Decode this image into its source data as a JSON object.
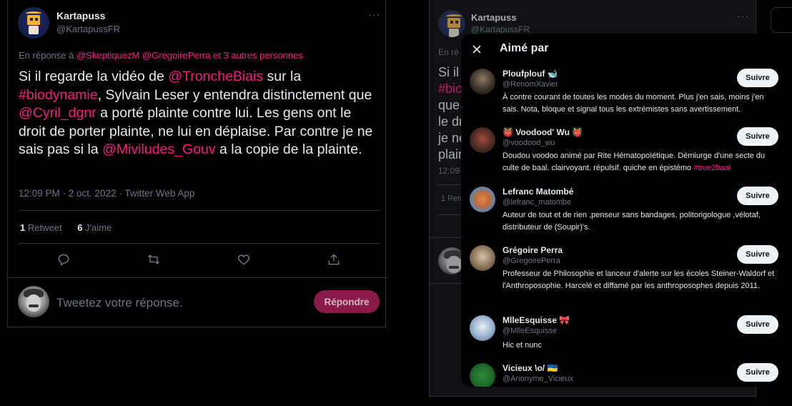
{
  "left_tweet": {
    "author_name": "Kartapuss",
    "author_handle": "@KartapussFR",
    "reply_prefix": "En réponse à",
    "reply_mentions": "@SkeptiquezM @GregoirePerra  et 3 autres personnes",
    "text_parts": {
      "p1": "Si il regarde la vidéo de ",
      "m1": "@TroncheBiais",
      "p2": " sur la ",
      "m2": "#biodynamie",
      "p3": ", Sylvain Leser y entendra distinctement que ",
      "m3": "@Cyril_dgnr",
      "p4": " a porté plainte contre lui. Les gens ont le droit de porter plainte, ne lui en déplaise. Par contre je ne sais pas si la ",
      "m4": "@Miviludes_Gouv",
      "p5": " a la copie de la plainte."
    },
    "meta": "12:09 PM · 2 oct. 2022 · Twitter Web App",
    "retweets_count": "1",
    "retweets_label": "Retweet",
    "likes_count": "6",
    "likes_label": "J'aime",
    "reply_placeholder": "Tweetez votre réponse.",
    "reply_button": "Répondre"
  },
  "right_tweet": {
    "author_name": "Kartapuss",
    "author_handle": "@KartapussFR",
    "reply_prefix": "En ré",
    "text_fragments": [
      "Si il",
      "#bio",
      "que",
      "le dr",
      "je ne",
      "plain"
    ],
    "time": "12:09",
    "stats": "1 Retw"
  },
  "modal": {
    "title": "Aimé par",
    "follow_label": "Suivre",
    "likers": [
      {
        "name": "Ploufplouf 🐋",
        "handle": "@RenomXavier",
        "bio": "À contre courant de toutes les modes du moment. Plus j'en sais, moins j'en sais. Nota, bloque et signal tous les extrémistes sans avertissement.",
        "bio_tag": ""
      },
      {
        "name": "👹 Voodood' Wu 👹",
        "handle": "@voodood_wu",
        "bio": "Doudou voodoo animé par Rite Hématopoïétique. Démiurge d'une secte du culte de baal. clairvoyant. répulsif. quiche en épistémo ",
        "bio_tag": "#true2baal"
      },
      {
        "name": "Lefranc Matombé",
        "handle": "@lefranc_matombe",
        "bio": "Auteur de tout et de rien ,penseur sans bandages, politorigologue ,vélotaf, distributeur de (Soupir)'s.",
        "bio_tag": ""
      },
      {
        "name": "Grégoire Perra",
        "handle": "@GregoirePerra",
        "bio": "Professeur de Philosophie et lanceur d'alerte sur les écoles Steiner-Waldorf et l'Anthroposophie. Harcelé et diffamé par les anthroposophes depuis 2011.",
        "bio_tag": ""
      },
      {
        "name": "MlleEsquisse 🎀",
        "handle": "@MlleEsquisse",
        "bio": "Hic et nunc",
        "bio_tag": ""
      },
      {
        "name": "Vicieux \\o/ 🇺🇦",
        "handle": "@Anonyme_Vicieux",
        "bio": "",
        "bio_tag": ""
      }
    ]
  },
  "colors": {
    "background": "#000000",
    "text": "#e7e9ea",
    "muted": "#71767b",
    "accent": "#f91880",
    "reply_button_bg": "#8a1a4a"
  },
  "icons": [
    "more-icon",
    "reply-icon",
    "retweet-icon",
    "like-icon",
    "share-icon",
    "close-icon"
  ]
}
